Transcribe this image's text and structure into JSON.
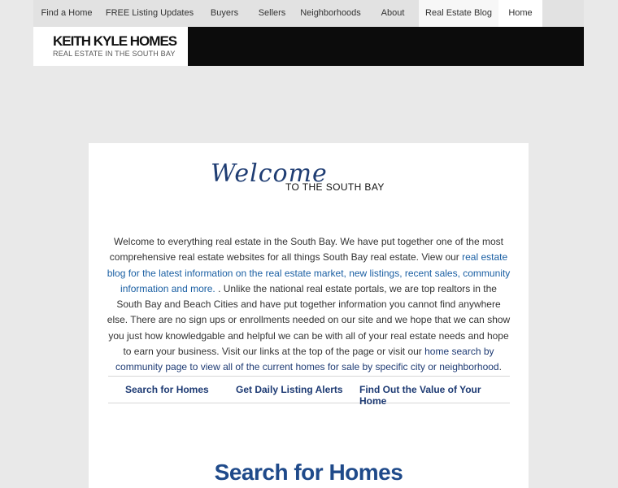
{
  "nav": {
    "items": [
      {
        "label": "Find a Home"
      },
      {
        "label": "FREE Listing Updates"
      },
      {
        "label": "Buyers"
      },
      {
        "label": "Sellers"
      },
      {
        "label": "Neighborhoods"
      },
      {
        "label": "About"
      },
      {
        "label": "Real Estate Blog"
      },
      {
        "label": "Home"
      }
    ]
  },
  "logo": {
    "name": "KEITH KYLE HOMES",
    "tagline": "REAL ESTATE IN THE SOUTH BAY"
  },
  "hero": {
    "script_title": "Welcome",
    "subtitle": "TO THE SOUTH BAY"
  },
  "intro": {
    "text1": "Welcome to everything real estate in the South Bay. We have put together one of the most comprehensive real estate websites for all things South Bay real estate. View our ",
    "blog_link": "real estate blog for the latest information on the real estate market, new listings, recent sales, community information and more.",
    "text2": " . Unlike the national real estate portals, we are top realtors in the South Bay and Beach Cities and have put together information you cannot find anywhere else. There are no sign ups or enrollments needed on our site and we hope that we can show you just how knowledgable and helpful we can be with all of your real estate needs and hope to earn your business. Visit our links at the top of the page or visit our ",
    "community_link": "home search by community page to view all of the current homes for sale by specific city or neighborhood",
    "text3": "."
  },
  "quick_links": [
    {
      "label": "Search for Homes"
    },
    {
      "label": "Get Daily Listing Alerts"
    },
    {
      "label": "Find Out the Value of Your Home"
    }
  ],
  "section": {
    "title": "Search for Homes"
  }
}
